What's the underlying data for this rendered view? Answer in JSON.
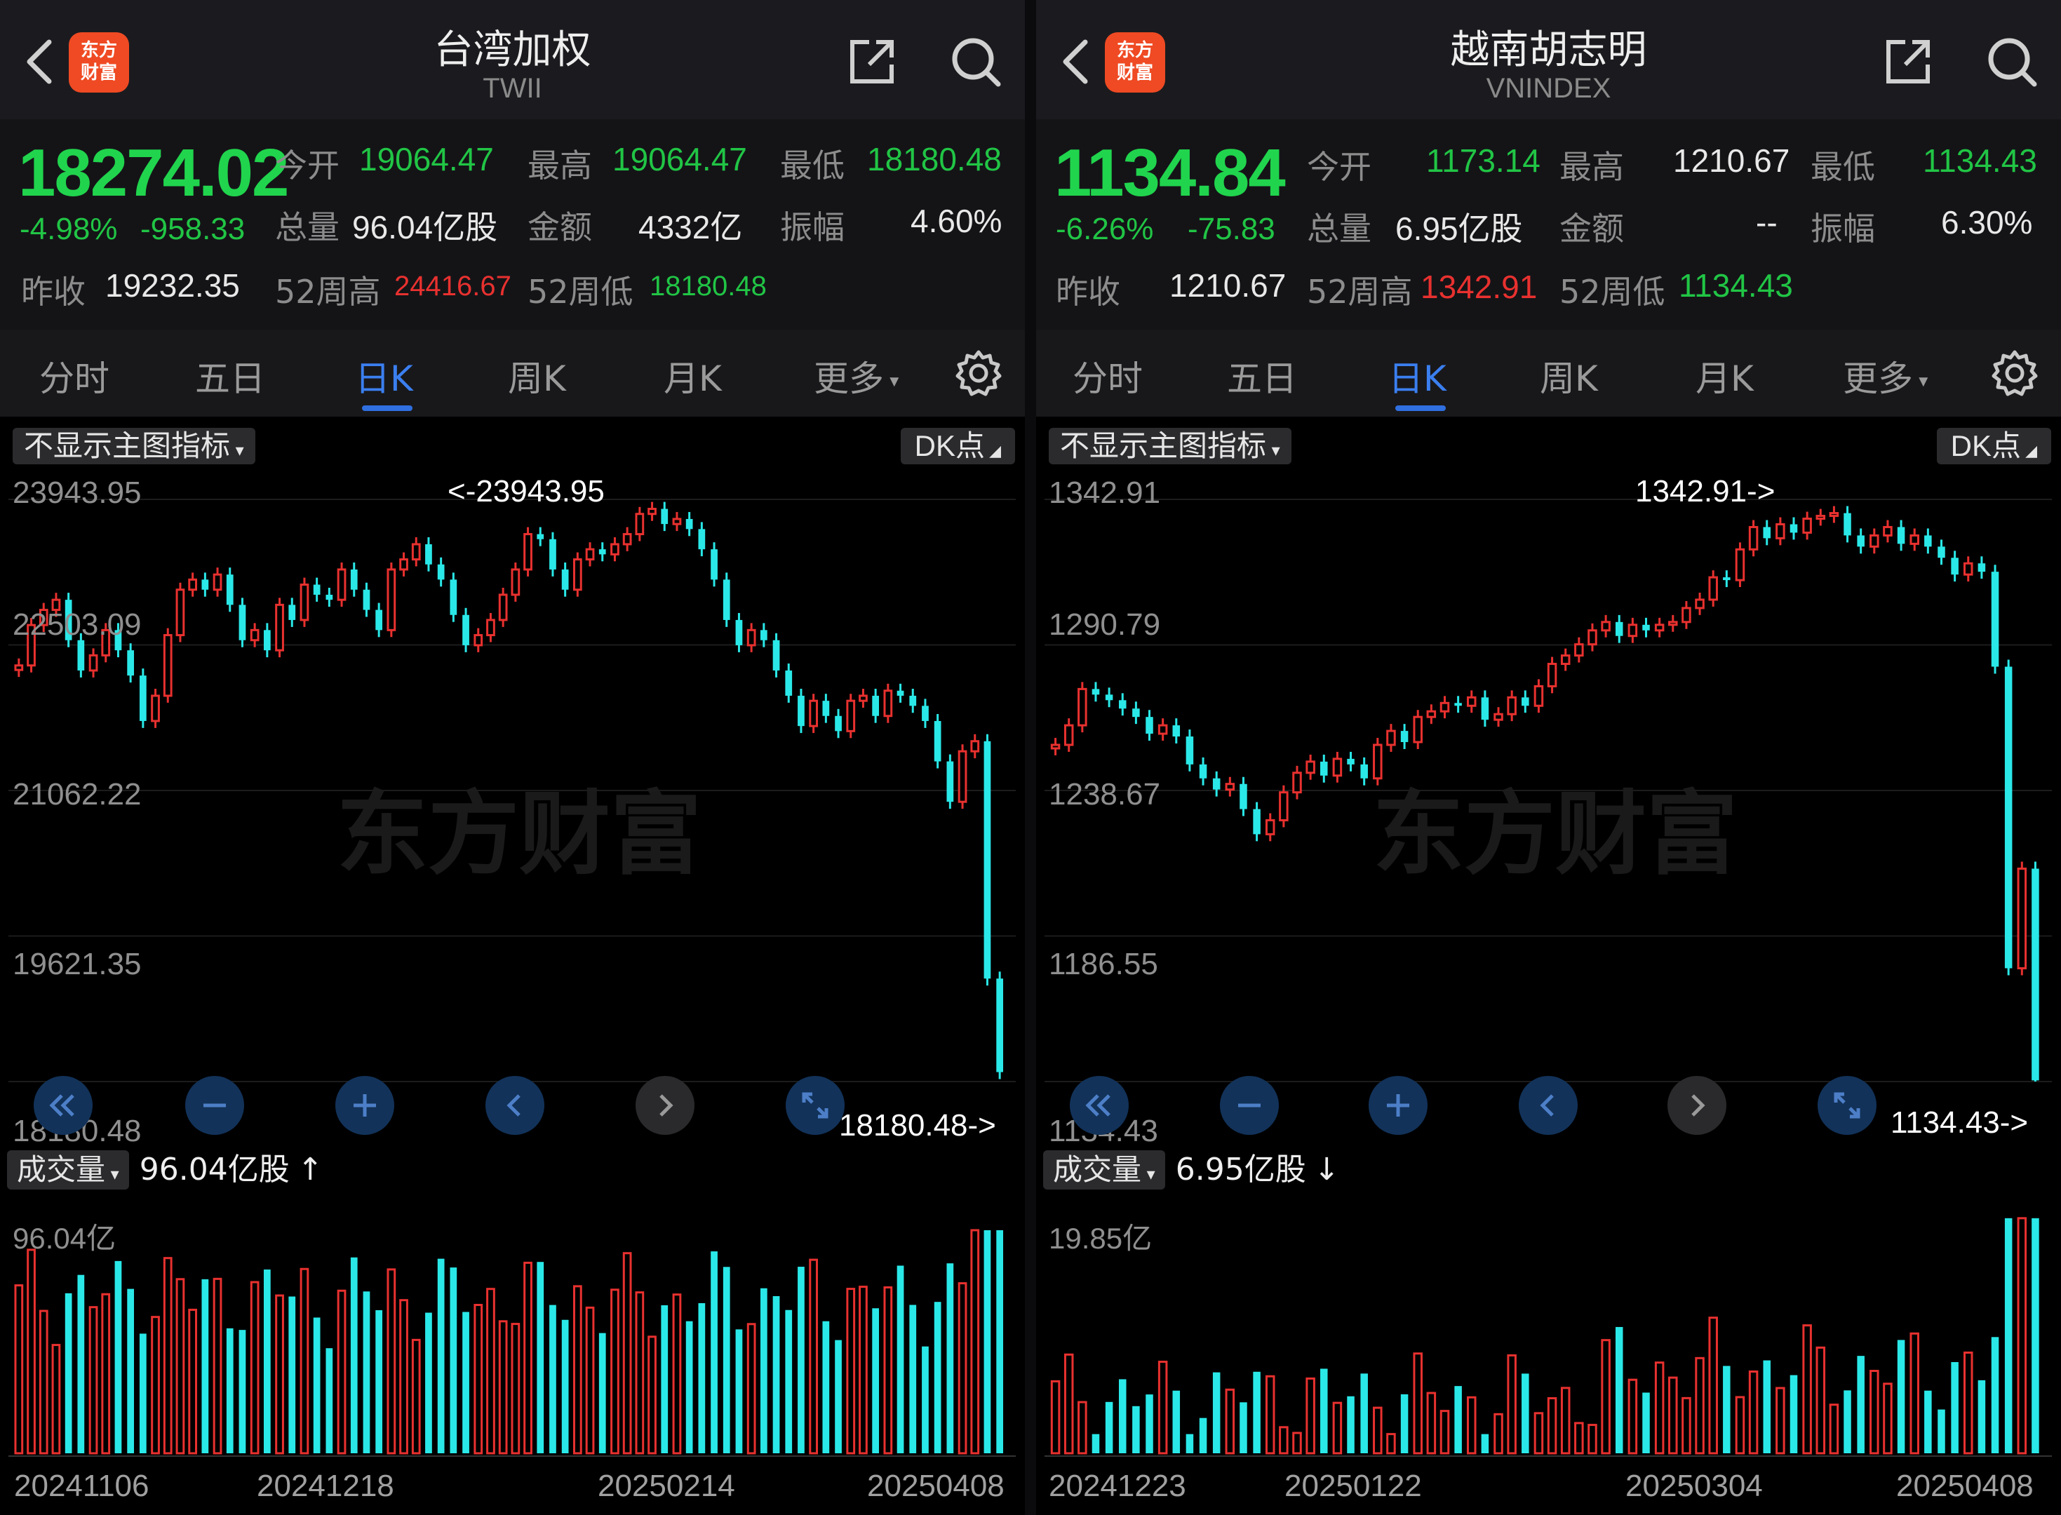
{
  "left": {
    "title": "台湾加权",
    "code": "TWII",
    "logo": "东方\n财富",
    "price": "18274.02",
    "change_pct": "-4.98%",
    "change_abs": "-958.33",
    "open_label": "今开",
    "open": "19064.47",
    "high_label": "最高",
    "high": "19064.47",
    "low_label": "最低",
    "low": "18180.48",
    "vol_label": "总量",
    "vol": "96.04亿股",
    "amount_label": "金额",
    "amount": "4332亿",
    "amp_label": "振幅",
    "amp": "4.60%",
    "prev_label": "昨收",
    "prev": "19232.35",
    "h52_label": "52周高",
    "h52": "24416.67",
    "l52_label": "52周低",
    "l52": "18180.48",
    "tabs": [
      "分时",
      "五日",
      "日K",
      "周K",
      "月K",
      "更多"
    ],
    "active_tab": 2,
    "indicator_btn": "不显示主图指标",
    "dk_btn": "DK点",
    "y_labels": [
      "23943.95",
      "22503.09",
      "21062.22",
      "19621.35",
      "18180.48"
    ],
    "max_annot": "<-23943.95",
    "min_annot": "18180.48->",
    "watermark": "东方财富",
    "volume_btn": "成交量",
    "volume_val": "96.04亿股",
    "volume_arrow": "↑",
    "vol_max_label": "96.04亿",
    "dates": [
      "20241106",
      "20241218",
      "20250214",
      "20250408"
    ]
  },
  "right": {
    "title": "越南胡志明",
    "code": "VNINDEX",
    "logo": "东方\n财富",
    "price": "1134.84",
    "change_pct": "-6.26%",
    "change_abs": "-75.83",
    "open_label": "今开",
    "open": "1173.14",
    "high_label": "最高",
    "high": "1210.67",
    "low_label": "最低",
    "low": "1134.43",
    "vol_label": "总量",
    "vol": "6.95亿股",
    "amount_label": "金额",
    "amount": "--",
    "amp_label": "振幅",
    "amp": "6.30%",
    "prev_label": "昨收",
    "prev": "1210.67",
    "h52_label": "52周高",
    "h52": "1342.91",
    "l52_label": "52周低",
    "l52": "1134.43",
    "tabs": [
      "分时",
      "五日",
      "日K",
      "周K",
      "月K",
      "更多"
    ],
    "active_tab": 2,
    "indicator_btn": "不显示主图指标",
    "dk_btn": "DK点",
    "y_labels": [
      "1342.91",
      "1290.79",
      "1238.67",
      "1186.55",
      "1134.43"
    ],
    "max_annot": "1342.91->",
    "min_annot": "1134.43->",
    "watermark": "东方财富",
    "volume_btn": "成交量",
    "volume_val": "6.95亿股",
    "volume_arrow": "↓",
    "vol_max_label": "19.85亿",
    "dates": [
      "20241223",
      "20250122",
      "20250304",
      "20250408"
    ]
  },
  "colors": {
    "up": "#e8312f",
    "down": "#2ae8e8",
    "price_green": "#21d44d",
    "accent": "#3b7ff0",
    "logo": "#ef4a23"
  },
  "chart_data": [
    {
      "type": "candlestick",
      "title": "台湾加权",
      "ylim": [
        18180.48,
        23943.95
      ],
      "closes": [
        22300,
        22700,
        22850,
        22950,
        22550,
        22250,
        22400,
        22650,
        22450,
        22200,
        21750,
        22000,
        22600,
        23050,
        23150,
        23050,
        23200,
        22900,
        22550,
        22650,
        22450,
        22900,
        22750,
        23100,
        23000,
        22950,
        23250,
        23050,
        22850,
        22650,
        23250,
        23350,
        23500,
        23300,
        23150,
        22800,
        22500,
        22600,
        22750,
        23000,
        23250,
        23600,
        23550,
        23250,
        23050,
        23350,
        23450,
        23400,
        23500,
        23600,
        23800,
        23850,
        23700,
        23750,
        23650,
        23450,
        23150,
        22750,
        22500,
        22650,
        22550,
        22250,
        22000,
        21700,
        21950,
        21800,
        21650,
        21950,
        22000,
        21800,
        22050,
        22000,
        21900,
        21750,
        21350,
        20950,
        21450,
        21550,
        19200,
        18274
      ]
    },
    {
      "type": "candlestick",
      "title": "越南胡志明",
      "ylim": [
        1134.43,
        1342.91
      ],
      "closes": [
        1255,
        1262,
        1275,
        1273,
        1271,
        1268,
        1265,
        1259,
        1262,
        1258,
        1248,
        1243,
        1239,
        1241,
        1232,
        1223,
        1228,
        1238,
        1245,
        1249,
        1244,
        1250,
        1248,
        1243,
        1255,
        1260,
        1256,
        1265,
        1267,
        1270,
        1269,
        1272,
        1264,
        1266,
        1272,
        1269,
        1276,
        1284,
        1287,
        1291,
        1296,
        1299,
        1294,
        1298,
        1296,
        1298,
        1299,
        1304,
        1307,
        1315,
        1314,
        1325,
        1333,
        1329,
        1334,
        1331,
        1336,
        1337,
        1338,
        1330,
        1326,
        1330,
        1333,
        1327,
        1330,
        1326,
        1322,
        1316,
        1320,
        1317,
        1283,
        1175,
        1210.67,
        1134.84
      ]
    }
  ]
}
